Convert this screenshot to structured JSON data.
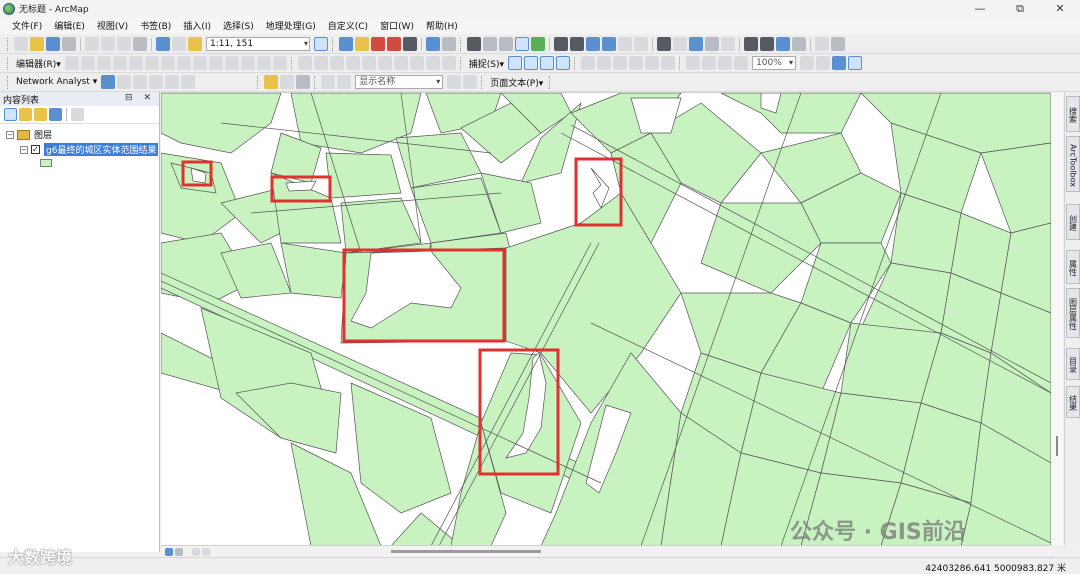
{
  "window": {
    "title": "无标题 - ArcMap",
    "controls": [
      "—",
      "⧉",
      "✕"
    ]
  },
  "menu": [
    "文件(F)",
    "编辑(E)",
    "视图(V)",
    "书签(B)",
    "插入(I)",
    "选择(S)",
    "地理处理(G)",
    "自定义(C)",
    "窗口(W)",
    "帮助(H)"
  ],
  "toolbar": {
    "scale": "1:11, 151",
    "editor_label": "编辑器(R)▾",
    "network_label": "Network Analyst ▾",
    "display_name_label": "显示名称",
    "snapping_label": "捕捉(S)▾",
    "zoom_level": "100%",
    "page_text_label": "页面文本(P)▾"
  },
  "toc": {
    "title": "内容列表",
    "pin": "⊟ ✕",
    "group": "图层",
    "layer": "g6最终的城区实体范围结果",
    "layer_checked": "✓"
  },
  "right_dock": [
    "搜索",
    "ArcToolbox",
    "创建",
    "属性",
    "图层属性",
    "目录",
    "结果"
  ],
  "status": {
    "coords": "42403286.641  5000983.827 米"
  },
  "watermark": {
    "left": "大数跨境",
    "right": "公众号 · GIS前沿"
  },
  "colors": {
    "map_fill": "#c8f3c0",
    "outline": "#555555",
    "highlight": "#e03030",
    "selection": "#3c7fd9"
  }
}
